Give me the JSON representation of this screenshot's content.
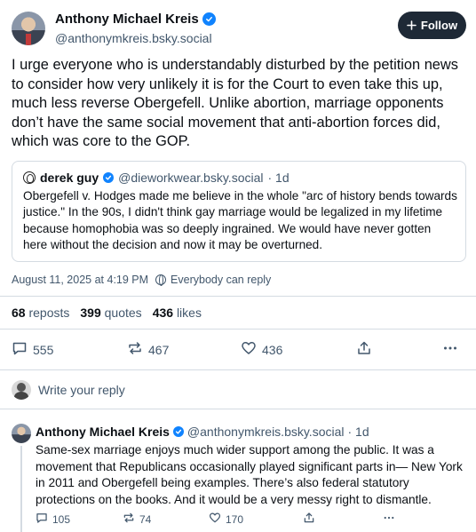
{
  "author": {
    "name": "Anthony Michael Kreis",
    "handle": "@anthonymkreis.bsky.social"
  },
  "follow_button": {
    "label": "Follow"
  },
  "post": {
    "text": "I urge everyone who is understandably disturbed by the petition news to consider how very unlikely it is for the Court to even take this up, much less reverse Obergefell. Unlike abortion, marriage opponents don’t have the same social movement that anti-abortion forces did, which was core to the GOP.",
    "timestamp": "August 11, 2025 at 4:19 PM",
    "visibility": "Everybody can reply"
  },
  "quote": {
    "name": "derek guy",
    "handle": "@dieworkwear.bsky.social",
    "age": "· 1d",
    "text": "Obergefell v. Hodges made me believe in the whole \"arc of history bends towards justice.\" In the 90s, I didn't think gay marriage would be legalized in my lifetime because homophobia was so deeply ingrained. We would have never gotten here without the decision and now it may be overturned."
  },
  "stats": [
    {
      "num": "68",
      "label": "reposts"
    },
    {
      "num": "399",
      "label": "quotes"
    },
    {
      "num": "436",
      "label": "likes"
    }
  ],
  "actions": {
    "replies": "555",
    "reposts": "467",
    "likes": "436"
  },
  "reply_box": {
    "placeholder": "Write your reply"
  },
  "reply": {
    "name": "Anthony Michael Kreis",
    "handle": "@anthonymkreis.bsky.social",
    "age": "· 1d",
    "text": "Same-sex marriage enjoys much wider support among the public. It was a movement that Republicans occasionally played significant parts in— New York in 2011 and Obergefell being examples. There’s also federal statutory protections on the books.  And it would be a very messy right to dismantle.",
    "replies": "105",
    "reposts": "74",
    "likes": "170"
  },
  "colors": {
    "accent": "#1083fe",
    "follow_bg": "#1e2936",
    "muted_text": "#42576c",
    "border": "#d4dbe2"
  },
  "icons": [
    "verified-badge-icon",
    "plus-icon",
    "globe-icon",
    "reply-icon",
    "repost-icon",
    "heart-icon",
    "share-icon",
    "more-icon"
  ]
}
